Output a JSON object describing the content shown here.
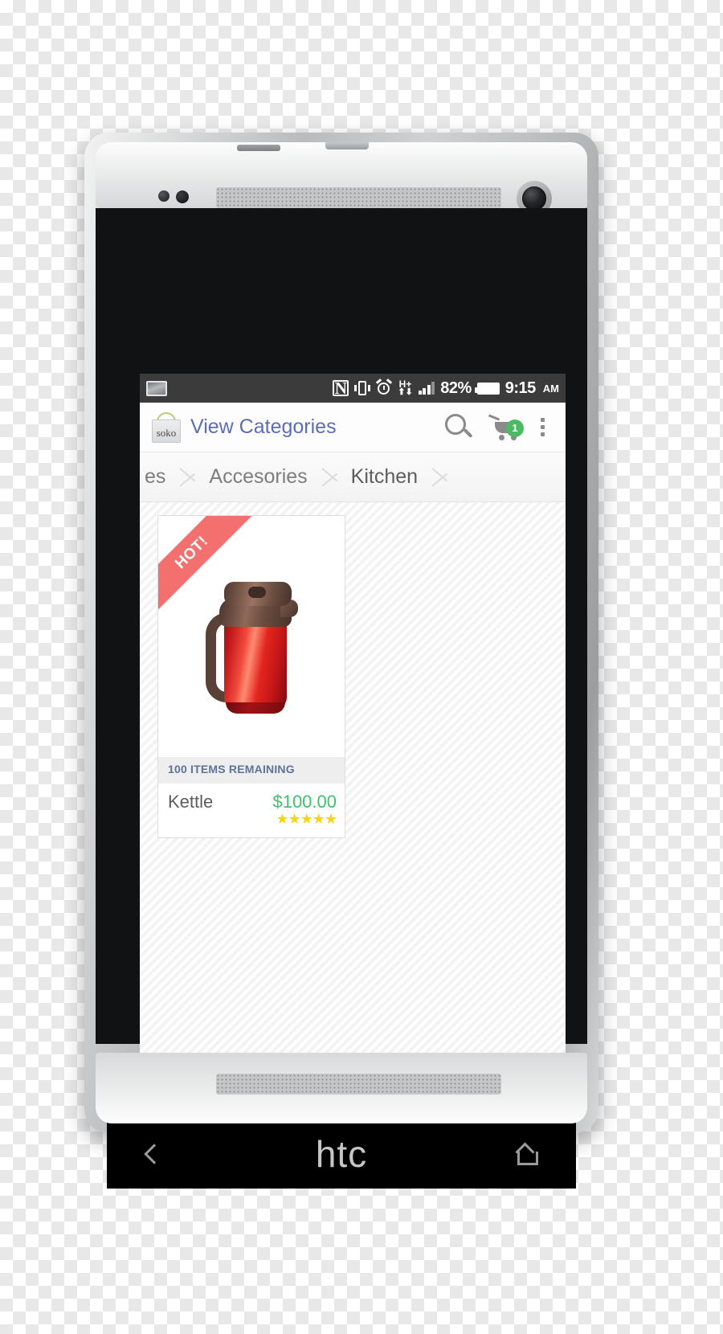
{
  "device": {
    "brand_logo": "htc",
    "nav": {
      "back_icon": "back-chevron-icon",
      "home_icon": "home-icon"
    }
  },
  "statusbar": {
    "screenshot_icon": "screenshot-icon",
    "nfc_icon": "N",
    "vibrate_icon": "vibrate-icon",
    "alarm_icon": "⏰",
    "network_type": "H+",
    "data_arrows": "data-transfer-icon",
    "battery_percent": "82%",
    "battery_icon": "battery-icon",
    "time": "9:15",
    "ampm": "AM"
  },
  "appbar": {
    "logo_text": "soko",
    "title": "View Categories",
    "search_icon": "search-icon",
    "cart_icon": "cart-icon",
    "cart_count": "1",
    "overflow_icon": "overflow-menu-icon"
  },
  "breadcrumb": {
    "items": [
      {
        "label": "es",
        "active": false
      },
      {
        "label": "Accesories",
        "active": false
      },
      {
        "label": "Kitchen",
        "active": true
      }
    ]
  },
  "product": {
    "ribbon": "HOT!",
    "image_alt": "red-kettle-photo",
    "stock_label": "100 ITEMS REMAINING",
    "name": "Kettle",
    "price": "$100.00",
    "rating_stars": "★★★★★",
    "rating_value": "5"
  },
  "colors": {
    "accent_blue": "#5b6eb5",
    "price_green": "#3ec06f",
    "badge_green": "#4cb963",
    "ribbon_red": "#f4706e",
    "star_yellow": "#f7d417",
    "stock_text": "#5d7398"
  }
}
